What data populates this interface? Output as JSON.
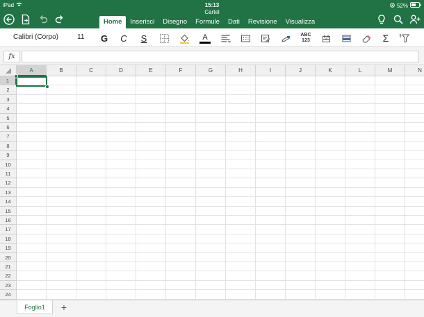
{
  "status_bar": {
    "device": "iPad",
    "time": "15:13",
    "battery": "52%"
  },
  "document": {
    "title": "Cartel"
  },
  "icons": {
    "back": "back-arrow-circle-icon",
    "file": "file-icon",
    "undo": "undo-icon",
    "redo": "redo-icon",
    "lightbulb": "lightbulb-icon",
    "search": "search-icon",
    "share": "add-person-icon"
  },
  "tabs": [
    {
      "label": "Home",
      "active": true
    },
    {
      "label": "Inserisci"
    },
    {
      "label": "Disegno"
    },
    {
      "label": "Formule"
    },
    {
      "label": "Dati"
    },
    {
      "label": "Revisione"
    },
    {
      "label": "Visualizza"
    }
  ],
  "ribbon": {
    "font_name": "Calibri (Corpo)",
    "font_size": "11",
    "bold_label": "G",
    "italic_label": "C",
    "underline_label": "S",
    "font_color_label": "A",
    "font_color": "#000000",
    "spelling_label_top": "ABC",
    "spelling_label_bottom": "123",
    "sum_label": "Σ"
  },
  "formula_bar": {
    "fx_label": "fx",
    "value": ""
  },
  "grid": {
    "columns": [
      "A",
      "B",
      "C",
      "D",
      "E",
      "F",
      "G",
      "H",
      "I",
      "J",
      "K",
      "L",
      "M",
      "N"
    ],
    "rows": [
      "1",
      "2",
      "3",
      "4",
      "5",
      "6",
      "7",
      "8",
      "9",
      "10",
      "11",
      "12",
      "13",
      "14",
      "15",
      "16",
      "17",
      "18",
      "19",
      "20",
      "21",
      "22",
      "23",
      "24"
    ],
    "selected_cell": "A1"
  },
  "sheets": {
    "tabs": [
      "Foglio1"
    ],
    "add_label": "+"
  },
  "colors": {
    "brand": "#217346",
    "header_bg": "#f0f0f0",
    "gridline": "#e3e3e3"
  }
}
